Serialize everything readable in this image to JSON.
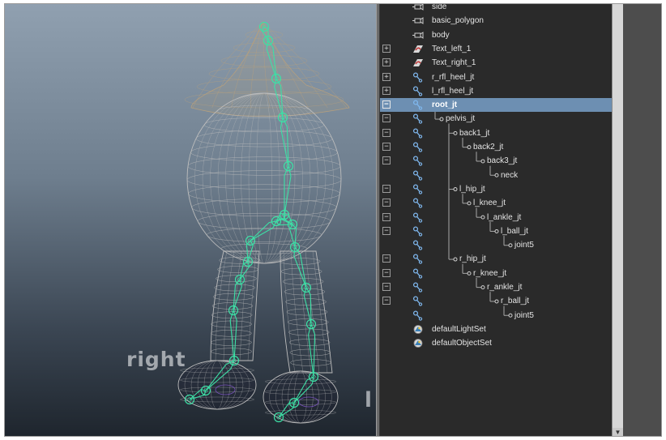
{
  "viewport": {
    "label_right": "right",
    "label_left": "l"
  },
  "outliner": {
    "rows": [
      {
        "label": "side",
        "icon": "camera-icon",
        "expander": "",
        "indent": 0
      },
      {
        "label": "basic_polygon",
        "icon": "camera-icon",
        "expander": "",
        "indent": 0
      },
      {
        "label": "body",
        "icon": "camera-icon",
        "expander": "",
        "indent": 0
      },
      {
        "label": "Text_left_1",
        "icon": "text-curve-icon",
        "expander": "+",
        "indent": 0
      },
      {
        "label": "Text_right_1",
        "icon": "text-curve-icon",
        "expander": "+",
        "indent": 0
      },
      {
        "label": "r_rfl_heel_jt",
        "icon": "joint-icon",
        "expander": "+",
        "indent": 0
      },
      {
        "label": "l_rfl_heel_jt",
        "icon": "joint-icon",
        "expander": "+",
        "indent": 0
      },
      {
        "label": "root_jt",
        "icon": "joint-icon",
        "expander": "-",
        "indent": 0,
        "selected": true
      },
      {
        "label": "pelvis_jt",
        "icon": "joint-icon",
        "expander": "-",
        "indent": 1
      },
      {
        "label": "back1_jt",
        "icon": "joint-icon",
        "expander": "-",
        "indent": 2
      },
      {
        "label": "back2_jt",
        "icon": "joint-icon",
        "expander": "-",
        "indent": 3
      },
      {
        "label": "back3_jt",
        "icon": "joint-icon",
        "expander": "-",
        "indent": 4
      },
      {
        "label": "neck",
        "icon": "joint-icon",
        "expander": "",
        "indent": 5
      },
      {
        "label": "l_hip_jt",
        "icon": "joint-icon",
        "expander": "-",
        "indent": 2
      },
      {
        "label": "l_knee_jt",
        "icon": "joint-icon",
        "expander": "-",
        "indent": 3
      },
      {
        "label": "l_ankle_jt",
        "icon": "joint-icon",
        "expander": "-",
        "indent": 4
      },
      {
        "label": "l_ball_jt",
        "icon": "joint-icon",
        "expander": "-",
        "indent": 5
      },
      {
        "label": "joint5",
        "icon": "joint-icon",
        "expander": "",
        "indent": 6
      },
      {
        "label": "r_hip_jt",
        "icon": "joint-icon",
        "expander": "-",
        "indent": 2
      },
      {
        "label": "r_knee_jt",
        "icon": "joint-icon",
        "expander": "-",
        "indent": 3
      },
      {
        "label": "r_ankle_jt",
        "icon": "joint-icon",
        "expander": "-",
        "indent": 4
      },
      {
        "label": "r_ball_jt",
        "icon": "joint-icon",
        "expander": "-",
        "indent": 5
      },
      {
        "label": "joint5",
        "icon": "joint-icon",
        "expander": "",
        "indent": 6
      },
      {
        "label": "defaultLightSet",
        "icon": "set-icon",
        "expander": "",
        "indent": 0
      },
      {
        "label": "defaultObjectSet",
        "icon": "set-icon",
        "expander": "",
        "indent": 0
      }
    ]
  },
  "scrollbar": {
    "down_arrow": "▼"
  },
  "colors": {
    "outliner_bg": "#2a2a2a",
    "selection": "#6d8fb2",
    "skeleton": "#3de0a6",
    "wireframe": "#bdbdbd",
    "joint_icon": "#7fb7ee"
  }
}
